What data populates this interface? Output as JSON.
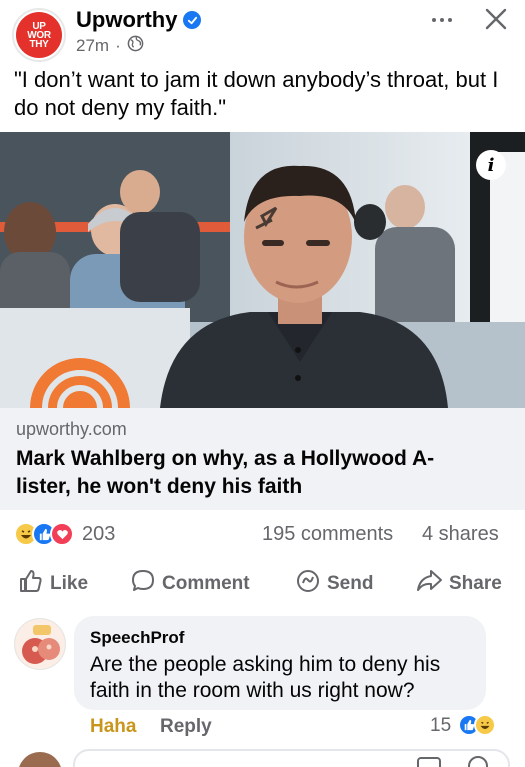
{
  "header": {
    "avatar_text": [
      "UP",
      "WOR",
      "THY"
    ],
    "page_name": "Upworthy",
    "time": "27m"
  },
  "post": {
    "text": "\"I don’t want to jam it down anybody’s throat, but I do not deny my faith.\""
  },
  "link": {
    "domain": "upworthy.com",
    "title": "Mark Wahlberg on why, as a Hollywood A-lister, he won't deny his faith"
  },
  "stats": {
    "reaction_count": "203",
    "comments": "195 comments",
    "shares": "4 shares"
  },
  "actions": {
    "like": "Like",
    "comment": "Comment",
    "send": "Send",
    "share": "Share"
  },
  "comment": {
    "author": "SpeechProf",
    "text": "Are the people asking him to deny his faith in the room with us right now?",
    "haha": "Haha",
    "reply": "Reply",
    "count": "15"
  },
  "colors": {
    "brand_red": "#e4312b",
    "fb_blue": "#1877f2",
    "haha_yellow": "#c8961b",
    "grey_text": "#65676b"
  },
  "icons": [
    "verified-badge-icon",
    "globe-icon",
    "more-icon",
    "close-icon",
    "info-icon",
    "like-icon",
    "comment-icon",
    "send-icon",
    "share-icon"
  ]
}
